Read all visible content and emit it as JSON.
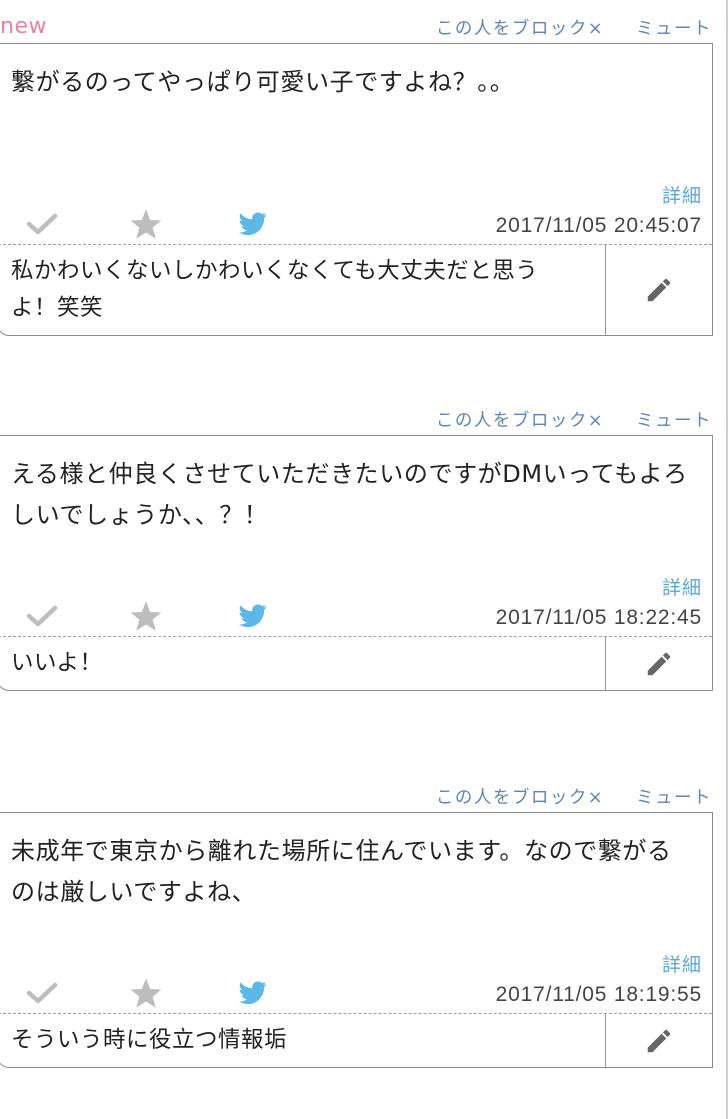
{
  "new_label": "new",
  "colors": {
    "new": "#ef7fa4",
    "action_link": "#5a86b8",
    "detail_link": "#5aa8d8",
    "twitter_blue": "#5bb8e8",
    "icon_gray": "#bdbdbd"
  },
  "posts": [
    {
      "block_label": "この人をブロック×",
      "mute_label": "ミュート",
      "comment": "繋がるのってやっぱり可愛い子ですよね？。。",
      "detail_label": "詳細",
      "timestamp": "2017/11/05 20:45:07",
      "reply": "私かわいくないしかわいくなくても大丈夫だと思うよ！笑笑"
    },
    {
      "block_label": "この人をブロック×",
      "mute_label": "ミュート",
      "comment": "える様と仲良くさせていただきたいのですがDMいってもよろしいでしょうか、、？！",
      "detail_label": "詳細",
      "timestamp": "2017/11/05 18:22:45",
      "reply": "いいよ！"
    },
    {
      "block_label": "この人をブロック×",
      "mute_label": "ミュート",
      "comment": "未成年で東京から離れた場所に住んでいます。なので繋がるのは厳しいですよね、",
      "detail_label": "詳細",
      "timestamp": "2017/11/05 18:19:55",
      "reply": "そういう時に役立つ情報垢"
    }
  ]
}
